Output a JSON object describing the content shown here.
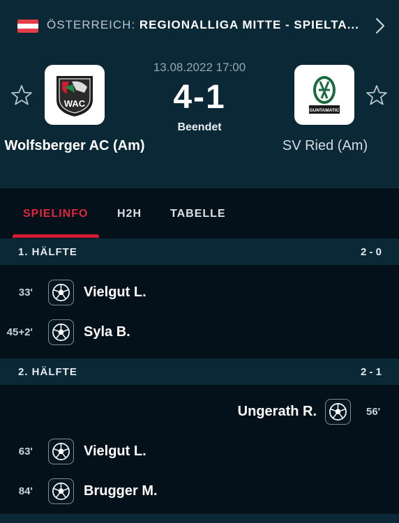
{
  "breadcrumb": {
    "country": "ÖSTERREICH: ",
    "league": "REGIONALLIGA MITTE - SPIELTA...",
    "flag_colors": [
      "#e63d4a",
      "#ffffff",
      "#e63d4a"
    ],
    "next_icon": "chevron-right-icon"
  },
  "match": {
    "datetime": "13.08.2022 17:00",
    "score": "4-1",
    "status": "Beendet",
    "home": {
      "name": "Wolfsberger AC (Am)",
      "logo_text": "WAC",
      "favorite_icon": "star-outline-icon"
    },
    "away": {
      "name": "SV Ried (Am)",
      "logo_text": "GUNTAMATIC",
      "favorite_icon": "star-outline-icon"
    }
  },
  "tabs": [
    {
      "label": "SPIELINFO",
      "active": true
    },
    {
      "label": "H2H",
      "active": false
    },
    {
      "label": "TABELLE",
      "active": false
    }
  ],
  "halves": [
    {
      "label": "1. HÄLFTE",
      "score": "2 - 0",
      "events": [
        {
          "side": "home",
          "minute": "33'",
          "player": "Vielgut L.",
          "icon": "soccer-ball-icon"
        },
        {
          "side": "home",
          "minute": "45+2'",
          "player": "Syla B.",
          "icon": "soccer-ball-icon"
        }
      ]
    },
    {
      "label": "2. HÄLFTE",
      "score": "2 - 1",
      "events": [
        {
          "side": "away",
          "minute": "56'",
          "player": "Ungerath R.",
          "icon": "soccer-ball-icon"
        },
        {
          "side": "home",
          "minute": "63'",
          "player": "Vielgut L.",
          "icon": "soccer-ball-icon"
        },
        {
          "side": "home",
          "minute": "84'",
          "player": "Brugger M.",
          "icon": "soccer-ball-icon"
        }
      ]
    }
  ],
  "colors": {
    "background": "#04111a",
    "panel": "#0b2836",
    "accent": "#d01c34"
  }
}
